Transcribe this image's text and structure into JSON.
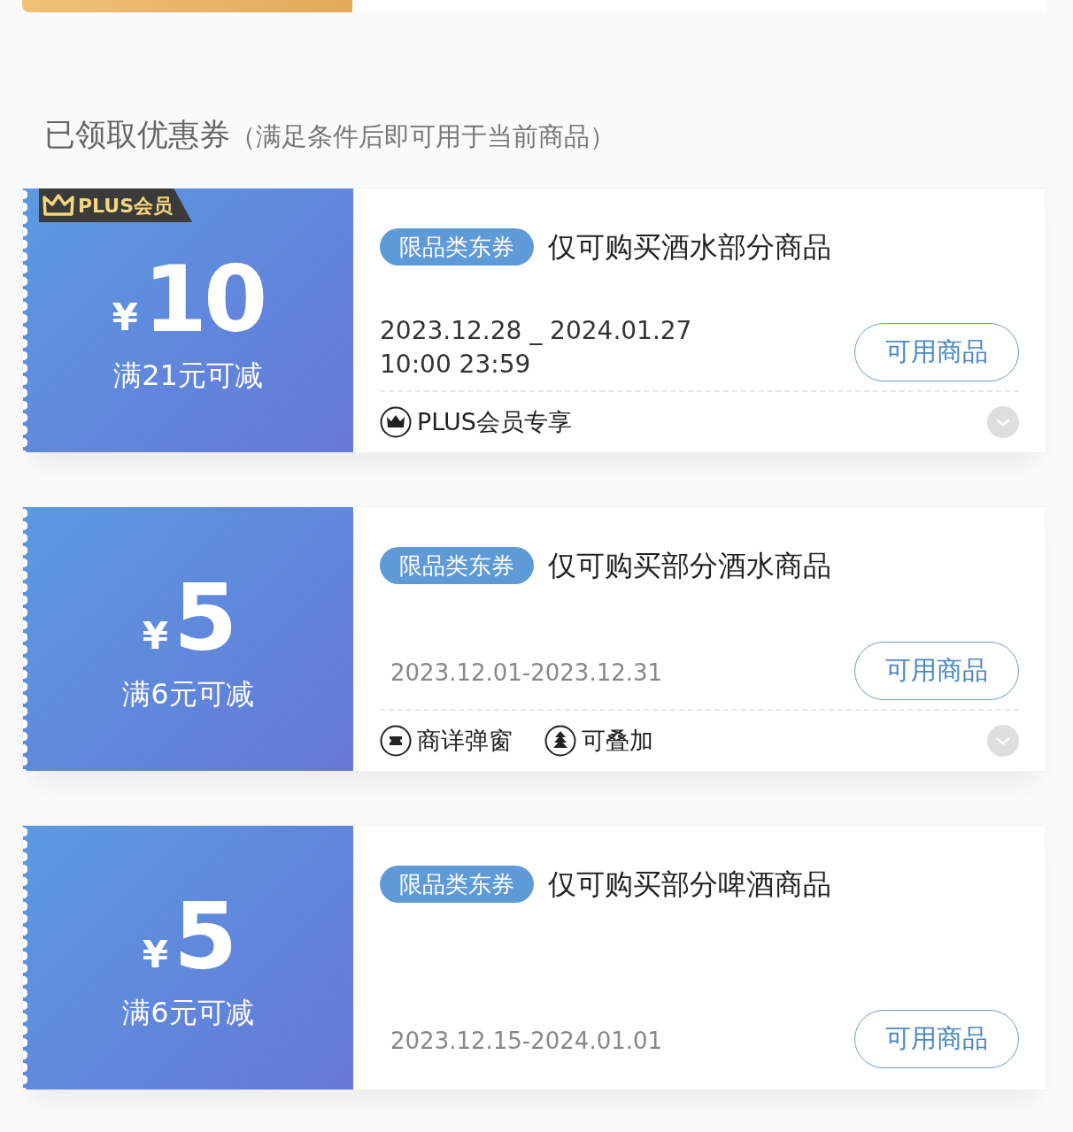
{
  "section_title": "已领取优惠券",
  "section_note": "（满足条件后即可用于当前商品）",
  "coupons": [
    {
      "badge": "PLUS会员",
      "currency": "¥",
      "amount": "10",
      "condition": "满21元可减",
      "tag": "限品类东券",
      "title": "仅可购买酒水部分商品",
      "validity": {
        "kind": "dark",
        "lines": [
          "2023.12.28 _ 2024.01.27",
          "10:00 23:59"
        ]
      },
      "button": "可用商品",
      "features": [
        {
          "kind": "plus",
          "label": "PLUS会员专享"
        }
      ],
      "expandable": true
    },
    {
      "currency": "¥",
      "amount": "5",
      "condition": "满6元可减",
      "tag": "限品类东券",
      "title": "仅可购买部分酒水商品",
      "validity": {
        "kind": "muted",
        "lines": [
          "2023.12.01-2023.12.31"
        ]
      },
      "button": "可用商品",
      "features": [
        {
          "kind": "popup",
          "label": "商详弹窗"
        },
        {
          "kind": "stack",
          "label": "可叠加"
        }
      ],
      "expandable": true
    },
    {
      "currency": "¥",
      "amount": "5",
      "condition": "满6元可减",
      "tag": "限品类东券",
      "title": "仅可购买部分啤酒商品",
      "validity": {
        "kind": "muted",
        "lines": [
          "2023.12.15-2024.01.01"
        ]
      },
      "button": "可用商品",
      "expandable": false
    }
  ]
}
